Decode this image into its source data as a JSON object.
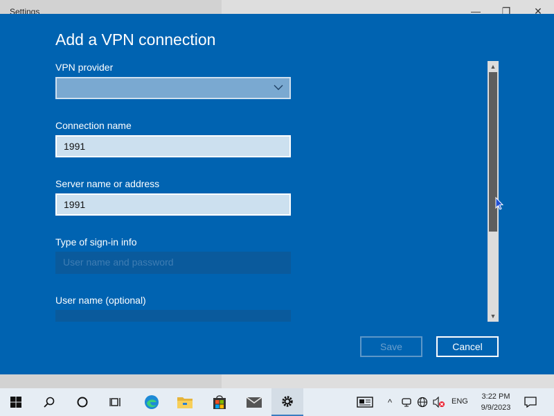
{
  "window": {
    "title": "Settings",
    "minimize_glyph": "—",
    "restore_glyph": "❐",
    "close_glyph": "✕"
  },
  "dialog": {
    "title": "Add a VPN connection",
    "vpn_provider": {
      "label": "VPN provider",
      "value": ""
    },
    "connection_name": {
      "label": "Connection name",
      "value": "1991"
    },
    "server": {
      "label": "Server name or address",
      "value": "1991"
    },
    "signin_type": {
      "label": "Type of sign-in info",
      "value": "User name and password"
    },
    "username": {
      "label": "User name (optional)",
      "value": ""
    },
    "save_label": "Save",
    "cancel_label": "Cancel"
  },
  "scrollbar": {
    "up_glyph": "▲",
    "down_glyph": "▼"
  },
  "taskbar": {
    "icons": [
      "windows-start-icon",
      "search-icon",
      "cortana-icon",
      "task-view-icon",
      "edge-icon",
      "file-explorer-icon",
      "store-icon",
      "mail-icon",
      "settings-gear-icon"
    ],
    "tray_chevron": "^",
    "language": "ENG",
    "time": "3:22 PM",
    "date": "9/9/2023"
  },
  "colors": {
    "dialog_bg": "#0063b1",
    "taskbar_bg": "#e6edf4",
    "accent": "#3a7cc0"
  }
}
